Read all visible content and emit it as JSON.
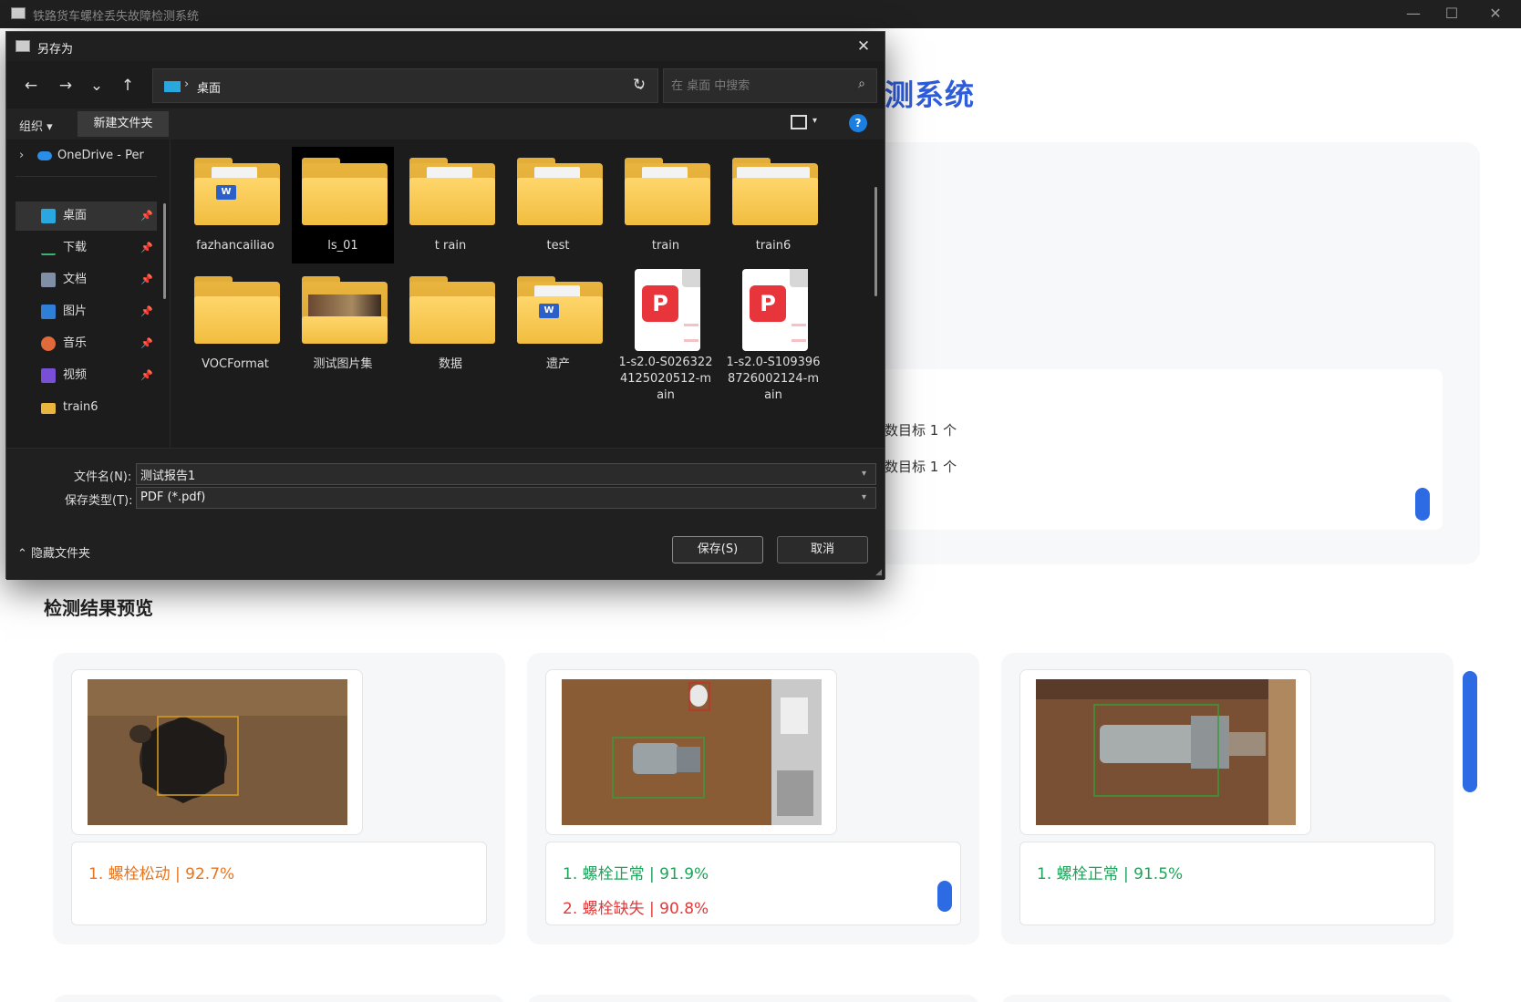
{
  "app": {
    "title": "铁路货车螺栓丢失故障检测系统",
    "heading": "测系统",
    "minimize": "—",
    "maximize": "☐",
    "close": "✕"
  },
  "log": {
    "line1": "数目标 1 个",
    "line2": "数目标 1 个"
  },
  "preview": {
    "title": "检测结果预览",
    "cards": [
      {
        "results": [
          {
            "text": "1. 螺栓松动 | 92.7%"
          }
        ]
      },
      {
        "results": [
          {
            "text": "1. 螺栓正常 | 91.9%"
          },
          {
            "text": "2. 螺栓缺失 | 90.8%"
          }
        ]
      },
      {
        "results": [
          {
            "text": "1. 螺栓正常 | 91.5%"
          }
        ]
      }
    ]
  },
  "dialog": {
    "title": "另存为",
    "close": "✕",
    "nav": {
      "back": "←",
      "forward": "→",
      "recent": "⌄",
      "up": "↑",
      "refresh": "↻"
    },
    "address": {
      "separator": "›",
      "crumb": "桌面",
      "dropdown": "⌄"
    },
    "search": {
      "placeholder": "在 桌面 中搜索",
      "icon": "⌕"
    },
    "commands": {
      "organize": "组织 ▾",
      "new_folder": "新建文件夹",
      "view_drop": "▾",
      "help": "?"
    },
    "nav_pane": {
      "onedrive": "OneDrive - Per",
      "items": [
        {
          "label": "桌面",
          "pin": "📌"
        },
        {
          "label": "下载",
          "pin": "📌"
        },
        {
          "label": "文档",
          "pin": "📌"
        },
        {
          "label": "图片",
          "pin": "📌"
        },
        {
          "label": "音乐",
          "pin": "📌"
        },
        {
          "label": "视频",
          "pin": "📌"
        },
        {
          "label": "train6"
        }
      ]
    },
    "files": [
      {
        "name": "fazhancailiao",
        "kind": "folder-word"
      },
      {
        "name": "ls_01",
        "kind": "folder"
      },
      {
        "name": "t rain",
        "kind": "folder-paper"
      },
      {
        "name": "test",
        "kind": "folder-paper"
      },
      {
        "name": "train",
        "kind": "folder-paper"
      },
      {
        "name": "train6",
        "kind": "folder-paper"
      },
      {
        "name": "VOCFormat",
        "kind": "folder"
      },
      {
        "name": "测试图片集",
        "kind": "folder-photo"
      },
      {
        "name": "数据",
        "kind": "folder"
      },
      {
        "name": "遗产",
        "kind": "folder-word"
      },
      {
        "name": "1-s2.0-S0263224125020512-main",
        "line1": "1-s2.0-S026322",
        "line2": "4125020512-m",
        "line3": "ain",
        "kind": "pdf"
      },
      {
        "name": "1-s2.0-S1093968726002124-main",
        "line1": "1-s2.0-S109396",
        "line2": "8726002124-m",
        "line3": "ain",
        "kind": "pdf"
      }
    ],
    "filename_label": "文件名(N):",
    "filename_value": "测试报告1",
    "filetype_label": "保存类型(T):",
    "filetype_value": "PDF (*.pdf)",
    "hide_folders": "⌃ 隐藏文件夹",
    "save": "保存(S)",
    "cancel": "取消"
  },
  "colors": {
    "accent": "#2f5cd8",
    "scrollbar": "#2d6be4",
    "loose": "#e8741f",
    "normal": "#1fa35a",
    "missing": "#e03a3a"
  }
}
